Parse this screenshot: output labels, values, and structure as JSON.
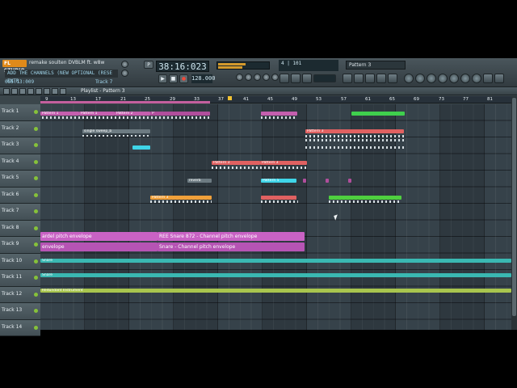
{
  "toolbar": {
    "logo": "FL STUDIO",
    "song_name": "remake soulten DVBLM ft. w8w",
    "hint_text": "ADD THE CHANNELS (NEW OPTIONAL (RESE ENTR",
    "timestamp": "055:13:009",
    "track_selector": "Track 7",
    "song_time": "38:16:023",
    "tempo": "128.000",
    "pattern_label": "P",
    "cpu_readout": "4 | 101",
    "preset_name": "Pattern 3",
    "transport": [
      "play",
      "stop",
      "record"
    ]
  },
  "playlist": {
    "title": "Playlist - Pattern 3",
    "ruler_ticks": [
      "9",
      "13",
      "17",
      "21",
      "25",
      "29",
      "33",
      "37",
      "41",
      "45",
      "49",
      "53",
      "57",
      "61",
      "65",
      "69",
      "73",
      "77",
      "81"
    ],
    "tracks": [
      "Track 1",
      "Track 2",
      "Track 3",
      "Track 4",
      "Track 5",
      "Track 6",
      "Track 7",
      "Track 8",
      "Track 9",
      "Track 10",
      "Track 11",
      "Track 12",
      "Track 13",
      "Track 14"
    ],
    "clips": {
      "t1_a": "Pattern 1",
      "t1_b": "Pattern 1",
      "t1_c": "Pattern 2",
      "t1_d": "P",
      "t2_a": "single sweep_b",
      "t2_b": "Pattern 3",
      "t4_a": "Pattern 3",
      "t4_b": "Pattern 3",
      "t5_a": "reverb",
      "t5_b": "Pattern 5",
      "t6_a": "Pattern 3",
      "t8_a": "ardel pitch envelope",
      "t8_b": "REE Snare 872 - Channel pitch envelope",
      "t9_a": "envelope",
      "t9_b": "Snare - Channel pitch envelope",
      "t10": "Snare",
      "t11": "Snare",
      "t12": "Redundant Instrument"
    }
  }
}
